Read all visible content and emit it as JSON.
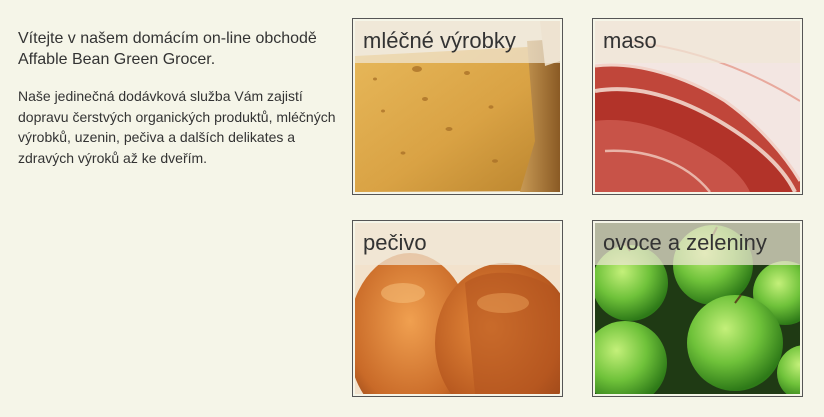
{
  "intro": {
    "welcome": "Vítejte v našem domácím on-line obchodě Affable Bean Green Grocer.",
    "description": "Naše jedinečná dodávková služba Vám zajistí dopravu čerstvých organických produktů, mléčných výrobků, uzenin, pečiva a dalších delikates a zdravých výroků až ke dveřím."
  },
  "categories": [
    {
      "label": "mléčné výrobky",
      "image": "cheese"
    },
    {
      "label": "maso",
      "image": "cured-ham"
    },
    {
      "label": "pečivo",
      "image": "bread"
    },
    {
      "label": "ovoce a zeleniny",
      "image": "green-apples"
    }
  ],
  "colors": {
    "background": "#f5f5e8",
    "text": "#333333",
    "tile_border": "#555555"
  }
}
